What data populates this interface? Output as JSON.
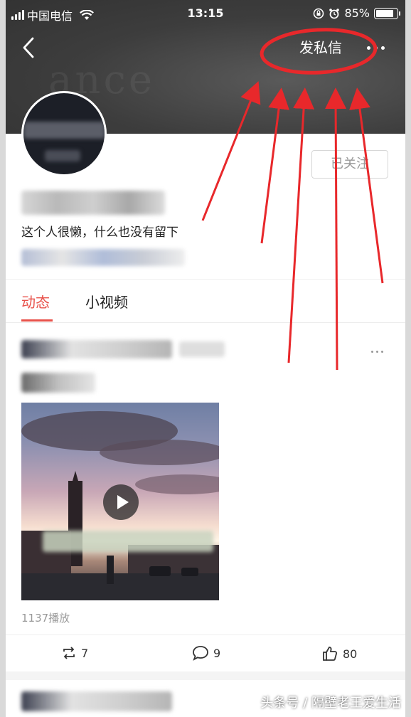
{
  "status_bar": {
    "carrier": "中国电信",
    "time": "13:15",
    "battery_percent_text": "85%",
    "battery_level": 0.85,
    "icons": [
      "signal-icon",
      "wifi-icon",
      "rotation-lock-icon",
      "alarm-icon",
      "battery-icon"
    ]
  },
  "nav": {
    "back_icon": "chevron-left-icon",
    "dm_label": "发私信",
    "more_icon": "more-dots-icon"
  },
  "profile": {
    "follow_label": "已关注",
    "bio": "这个人很懒，什么也没有留下"
  },
  "tabs": [
    {
      "label": "动态",
      "active": true
    },
    {
      "label": "小视频",
      "active": false
    }
  ],
  "post": {
    "play_count": "1137播放",
    "repost_count": "7",
    "comment_count": "9",
    "like_count": "80"
  },
  "watermark": "头条号 / 隔壁老王爱生活",
  "colors": {
    "accent": "#e8514a",
    "annotation": "#e8282b",
    "header_bg": "#3d3d3d"
  }
}
